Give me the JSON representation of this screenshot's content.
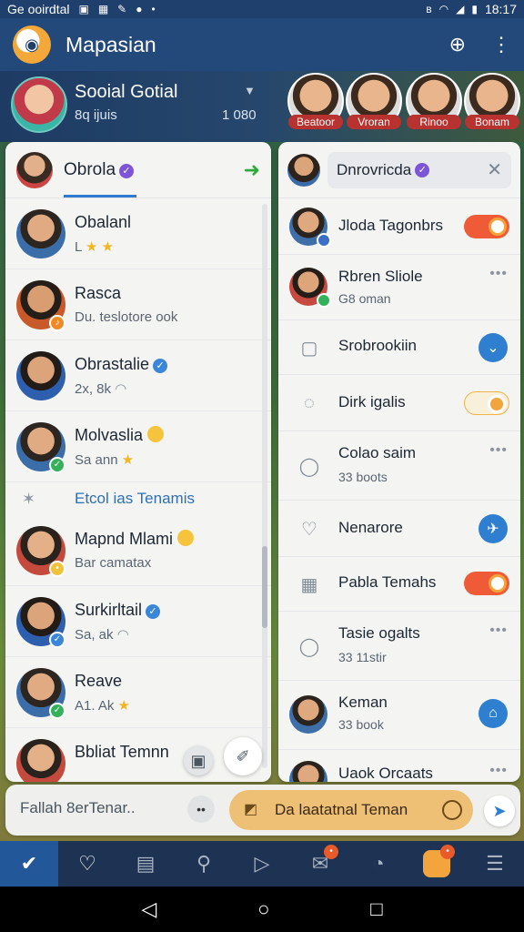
{
  "status_bar": {
    "left_text": "Ge ooirdtal",
    "time": "18:17"
  },
  "app_bar": {
    "title": "Mapasian"
  },
  "profile": {
    "name": "Sooial Gotial",
    "subtitle": "8q ijuis",
    "count": "1 080"
  },
  "stories": [
    {
      "label": "Beatoor"
    },
    {
      "label": "Vroran"
    },
    {
      "label": "Rinoo"
    },
    {
      "label": "Bonam"
    }
  ],
  "left_panel": {
    "title": "Obrola",
    "contacts_a": [
      {
        "name": "Obalanl",
        "sub": "L"
      },
      {
        "name": "Rasca",
        "sub": "Du. teslotore ook"
      },
      {
        "name": "Obrastalie",
        "sub": "2x, 8k"
      },
      {
        "name": "Molvaslia",
        "sub": "Sa ann"
      }
    ],
    "section_label": "Etcol ias Tenamis",
    "contacts_b": [
      {
        "name": "Mapnd Mlami",
        "sub": "Bar camatax"
      },
      {
        "name": "Surkirltail",
        "sub": "Sa, ak"
      },
      {
        "name": "Reave",
        "sub": "A1. Ak"
      },
      {
        "name": "Bbliat Temnn",
        "sub": ""
      }
    ]
  },
  "right_panel": {
    "search_text": "Dnrovricda",
    "rows": [
      {
        "name": "Jloda Tagonbrs",
        "sub": ""
      },
      {
        "name": "Rbren Sliole",
        "sub": "G8 oman"
      },
      {
        "name": "Srobrookiin",
        "sub": ""
      },
      {
        "name": "Dirk igalis",
        "sub": ""
      },
      {
        "name": "Colao saim",
        "sub": "33 boots"
      },
      {
        "name": "Nenarore",
        "sub": ""
      },
      {
        "name": "Pabla Temahs",
        "sub": ""
      },
      {
        "name": "Tasie ogalts",
        "sub": "33 11stir"
      },
      {
        "name": "Keman",
        "sub": "33 book"
      },
      {
        "name": "Uaok Orcaats",
        "sub": ""
      }
    ]
  },
  "composer": {
    "placeholder": "Fallah 8erTenar..",
    "pill_text": "Da laatatnal Teman"
  },
  "colors": {
    "accent": "#2f7fd1",
    "header": "#22497a",
    "toggle": "#ef5a37"
  }
}
